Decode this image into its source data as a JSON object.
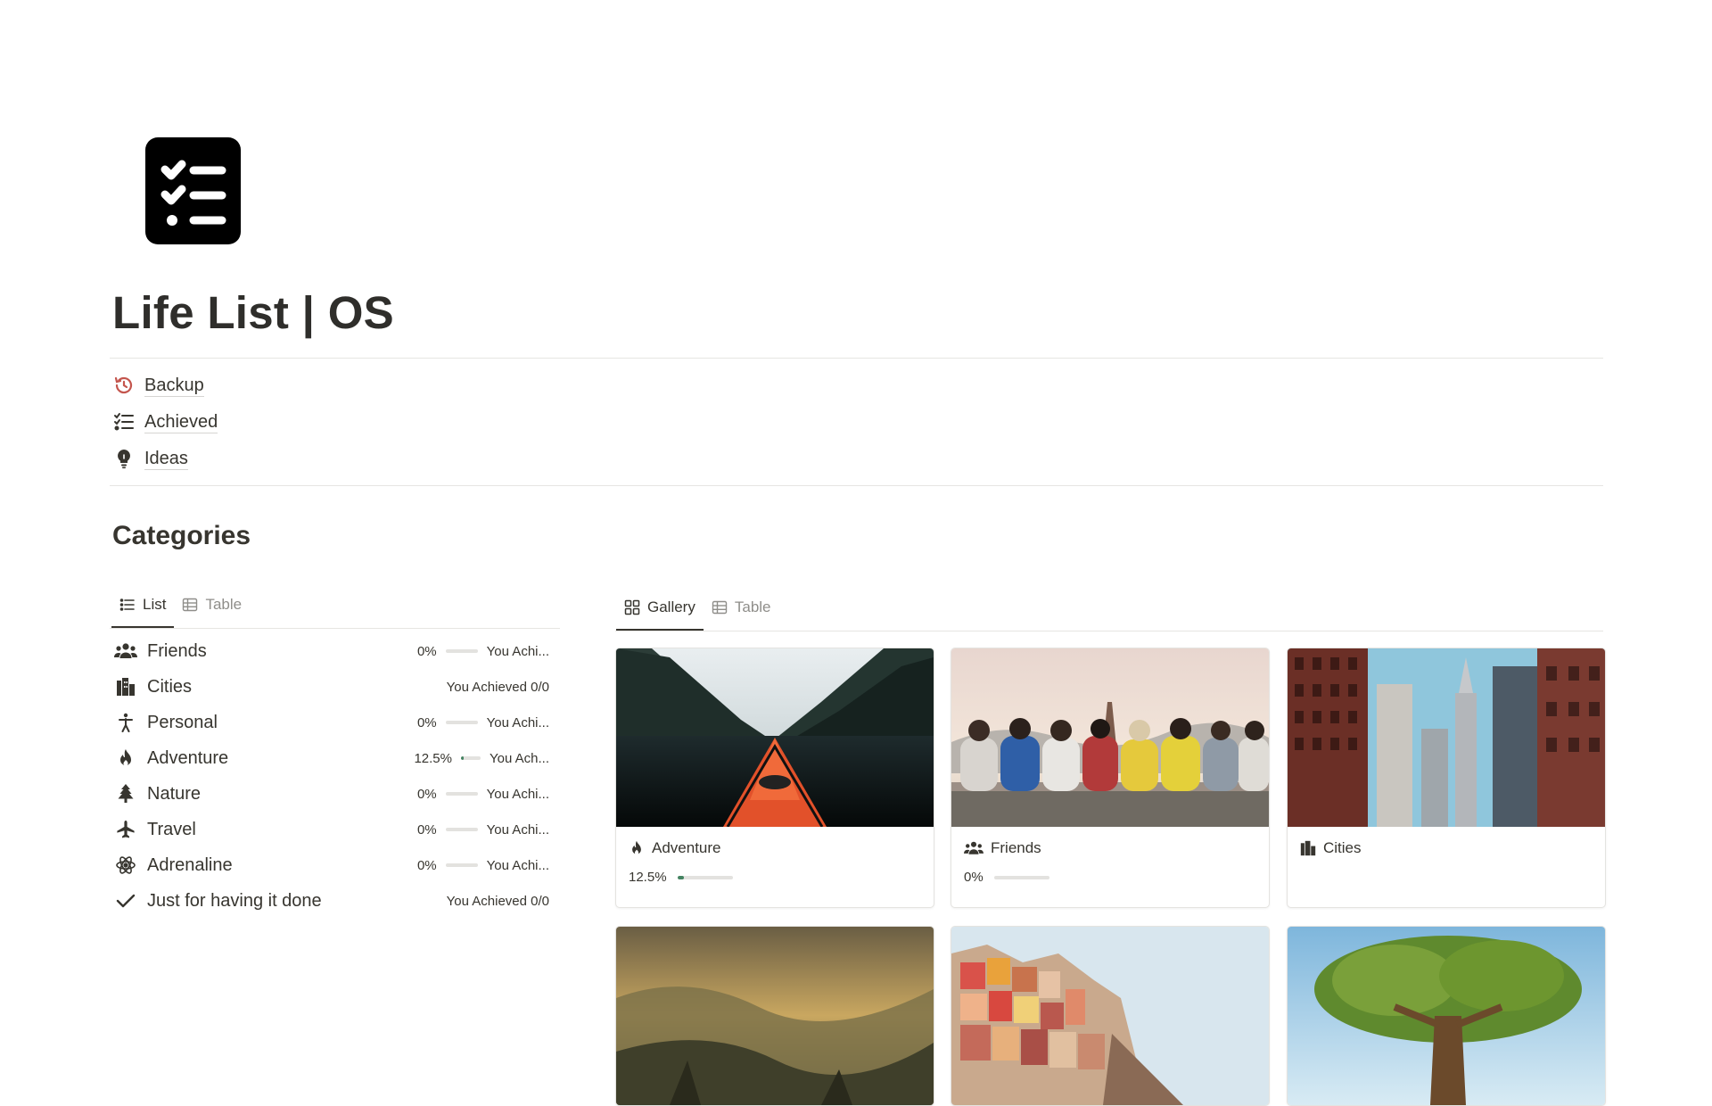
{
  "page": {
    "title": "Life List | OS",
    "icon": "checklist-icon"
  },
  "links": [
    {
      "label": "Backup",
      "icon": "history-icon",
      "color": "#c4554d"
    },
    {
      "label": "Achieved",
      "icon": "checklist-icon",
      "color": "#37352f"
    },
    {
      "label": "Ideas",
      "icon": "lightbulb-icon",
      "color": "#37352f"
    }
  ],
  "categories": {
    "heading": "Categories",
    "tabs": [
      {
        "label": "List",
        "icon": "list-icon",
        "active": true
      },
      {
        "label": "Table",
        "icon": "table-icon",
        "active": false
      }
    ],
    "items": [
      {
        "name": "Friends",
        "icon": "people-icon",
        "percent": "0%",
        "progress": 0,
        "achieved": "You Achi..."
      },
      {
        "name": "Cities",
        "icon": "city-icon",
        "percent": "",
        "progress": null,
        "achieved": "You Achieved 0/0"
      },
      {
        "name": "Personal",
        "icon": "person-icon",
        "percent": "0%",
        "progress": 0,
        "achieved": "You Achi..."
      },
      {
        "name": "Adventure",
        "icon": "fire-icon",
        "percent": "12.5%",
        "progress": 0.125,
        "achieved": "You Ach..."
      },
      {
        "name": "Nature",
        "icon": "tree-icon",
        "percent": "0%",
        "progress": 0,
        "achieved": "You Achi..."
      },
      {
        "name": "Travel",
        "icon": "airplane-icon",
        "percent": "0%",
        "progress": 0,
        "achieved": "You Achi..."
      },
      {
        "name": "Adrenaline",
        "icon": "atom-icon",
        "percent": "0%",
        "progress": 0,
        "achieved": "You Achi..."
      },
      {
        "name": "Just for having it done",
        "icon": "checkmark-icon",
        "percent": "",
        "progress": null,
        "achieved": "You Achieved 0/0"
      }
    ]
  },
  "gallery": {
    "tabs": [
      {
        "label": "Gallery",
        "icon": "gallery-icon",
        "active": true
      },
      {
        "label": "Table",
        "icon": "table-icon",
        "active": false
      }
    ],
    "cards": [
      {
        "title": "Adventure",
        "icon": "fire-icon",
        "percent": "12.5%",
        "progress": 0.125,
        "cover": "kayak-fjord"
      },
      {
        "title": "Friends",
        "icon": "people-icon",
        "percent": "0%",
        "progress": 0,
        "cover": "friends-sunset"
      },
      {
        "title": "Cities",
        "icon": "city-icon",
        "percent": "",
        "progress": null,
        "cover": "city-buildings"
      },
      {
        "title": "",
        "icon": "",
        "percent": "",
        "progress": null,
        "cover": "mountain-valley"
      },
      {
        "title": "",
        "icon": "",
        "percent": "",
        "progress": null,
        "cover": "colorful-coastal-town"
      },
      {
        "title": "",
        "icon": "",
        "percent": "",
        "progress": null,
        "cover": "big-tree"
      }
    ]
  },
  "colors": {
    "text": "#37352f",
    "muted": "#8f8e8a",
    "progress": "#448361",
    "backup": "#c4554d"
  }
}
